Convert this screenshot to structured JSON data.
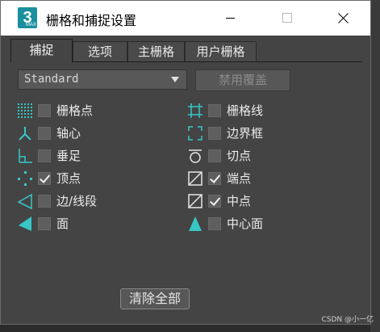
{
  "window": {
    "title": "栅格和捕捉设置",
    "app_icon": {
      "text": "3",
      "subtext": "MAX"
    }
  },
  "tabs": [
    "捕捉",
    "选项",
    "主栅格",
    "用户栅格"
  ],
  "active_tab": 0,
  "dropdown": {
    "value": "Standard"
  },
  "override_button": "禁用覆盖",
  "snaps": [
    {
      "label": "栅格点",
      "checked": false,
      "icon": "grid-points-icon",
      "column": "left",
      "row": 0
    },
    {
      "label": "栅格线",
      "checked": false,
      "icon": "grid-lines-icon",
      "column": "right",
      "row": 0
    },
    {
      "label": "轴心",
      "checked": false,
      "icon": "pivot-icon",
      "column": "left",
      "row": 1
    },
    {
      "label": "边界框",
      "checked": false,
      "icon": "bounding-box-icon",
      "column": "right",
      "row": 1
    },
    {
      "label": "垂足",
      "checked": false,
      "icon": "perpendicular-icon",
      "column": "left",
      "row": 2
    },
    {
      "label": "切点",
      "checked": false,
      "icon": "tangent-icon",
      "column": "right",
      "row": 2
    },
    {
      "label": "顶点",
      "checked": true,
      "icon": "vertex-icon",
      "column": "left",
      "row": 3
    },
    {
      "label": "端点",
      "checked": true,
      "icon": "endpoint-icon",
      "column": "right",
      "row": 3
    },
    {
      "label": "边/线段",
      "checked": false,
      "icon": "edge-segment-icon",
      "column": "left",
      "row": 4
    },
    {
      "label": "中点",
      "checked": true,
      "icon": "midpoint-icon",
      "column": "right",
      "row": 4
    },
    {
      "label": "面",
      "checked": false,
      "icon": "face-icon",
      "column": "left",
      "row": 5
    },
    {
      "label": "中心面",
      "checked": false,
      "icon": "center-face-icon",
      "column": "right",
      "row": 5
    }
  ],
  "clear_button": "清除全部",
  "watermark": "CSDN @小一亿",
  "colors": {
    "icon_accent": "#38c6c6",
    "panel_bg": "#444444"
  }
}
